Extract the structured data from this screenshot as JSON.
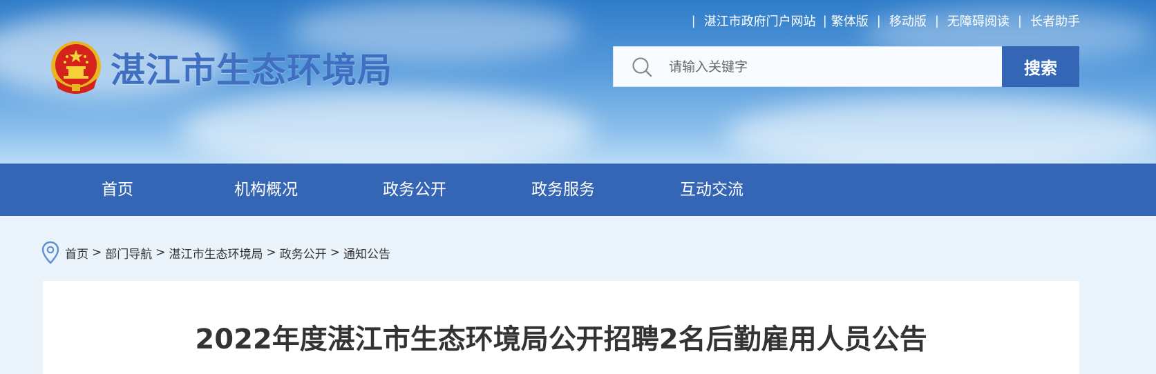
{
  "top_links": {
    "portal": "湛江市政府门户网站",
    "traditional": "繁体版",
    "mobile": "移动版",
    "accessible": "无障碍阅读",
    "elderly": "长者助手"
  },
  "site": {
    "title": "湛江市生态环境局"
  },
  "search": {
    "placeholder": "请输入关键字",
    "button_label": "搜索"
  },
  "nav": {
    "items": [
      {
        "label": "首页"
      },
      {
        "label": "机构概况"
      },
      {
        "label": "政务公开"
      },
      {
        "label": "政务服务"
      },
      {
        "label": "互动交流"
      }
    ]
  },
  "breadcrumb": {
    "items": [
      "首页",
      "部门导航",
      "湛江市生态环境局",
      "政务公开",
      "通知公告"
    ],
    "separator": ">"
  },
  "article": {
    "title": "2022年度湛江市生态环境局公开招聘2名后勤雇用人员公告"
  },
  "colors": {
    "brand_blue": "#3565b5",
    "title_blue": "#3f6fc0",
    "page_bg": "#eaf2fa"
  }
}
